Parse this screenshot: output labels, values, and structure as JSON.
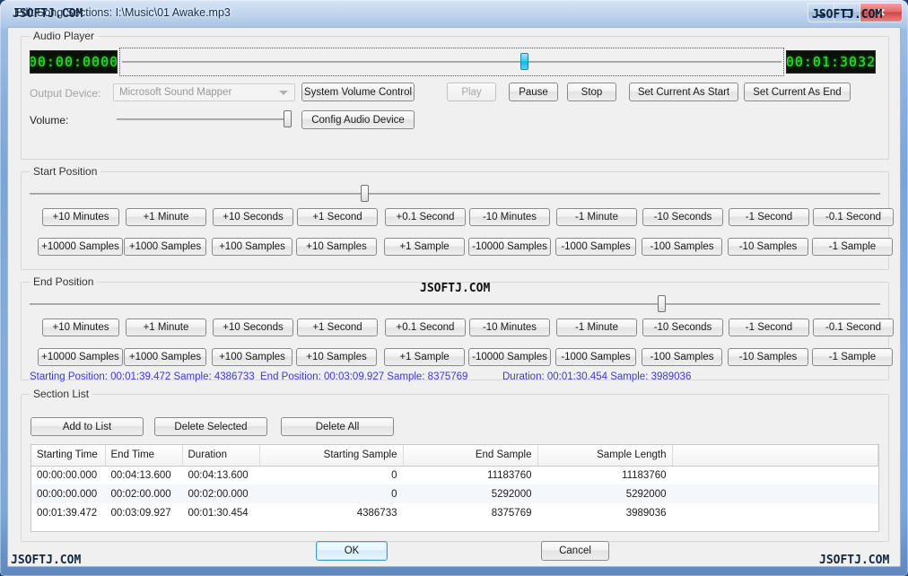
{
  "window": {
    "title": "Edit Song Sections:  I:\\Music\\01  Awake.mp3",
    "minimize_label": "minimize",
    "maximize_label": "maximize",
    "close_label": "✕"
  },
  "watermarks": {
    "title_left": "JSOFTJ.COM",
    "title_right": "JSOFTJ.COM",
    "middle": "JSOFTJ.COM",
    "bottom_left": "JSOFTJ.COM",
    "bottom_right": "JSOFTJ.COM"
  },
  "audio_player": {
    "group_title": "Audio Player",
    "lcd_left": {
      "ghost": "88:88:8888",
      "value": "00:00:0000"
    },
    "lcd_right": {
      "ghost": "88:88:8888",
      "value": "00:01:3032"
    },
    "seek_slider": {
      "name": "playback-position-slider",
      "percent": 61.2
    },
    "output_device_label": "Output Device:",
    "output_device_value": "Microsoft Sound Mapper",
    "volume_label": "Volume:",
    "volume_percent": 100,
    "buttons": [
      {
        "id": "system-volume-control",
        "label": "System Volume Control",
        "disabled": false
      },
      {
        "id": "play",
        "label": "Play",
        "disabled": true
      },
      {
        "id": "pause",
        "label": "Pause",
        "disabled": false
      },
      {
        "id": "stop",
        "label": "Stop",
        "disabled": false
      },
      {
        "id": "set-current-as-start",
        "label": "Set Current As Start",
        "disabled": false
      },
      {
        "id": "set-current-as-end",
        "label": "Set Current As End",
        "disabled": false
      },
      {
        "id": "config-audio-device",
        "label": "Config Audio Device",
        "disabled": false
      }
    ]
  },
  "start_position": {
    "group_title": "Start Position",
    "slider_percent": 39.3,
    "row1": [
      "+10 Minutes",
      "+1 Minute",
      "+10 Seconds",
      "+1 Second",
      "+0.1 Second",
      "-10 Minutes",
      "-1 Minute",
      "-10 Seconds",
      "-1 Second",
      "-0.1 Second"
    ],
    "row2": [
      "+10000 Samples",
      "+1000 Samples",
      "+100 Samples",
      "+10 Samples",
      "+1 Sample",
      "-10000 Samples",
      "-1000 Samples",
      "-100 Samples",
      "-10 Samples",
      "-1 Sample"
    ]
  },
  "end_position": {
    "group_title": "End Position",
    "slider_percent": 74.5,
    "row1": [
      "+10 Minutes",
      "+1 Minute",
      "+10 Seconds",
      "+1 Second",
      "+0.1 Second",
      "-10 Minutes",
      "-1 Minute",
      "-10 Seconds",
      "-1 Second",
      "-0.1 Second"
    ],
    "row2": [
      "+10000 Samples",
      "+1000 Samples",
      "+100 Samples",
      "+10 Samples",
      "+1 Sample",
      "-10000 Samples",
      "-1000 Samples",
      "-100 Samples",
      "-10 Samples",
      "-1 Sample"
    ]
  },
  "info": {
    "starting_position": "Starting Position: 00:01:39.472  Sample: 4386733",
    "end_position": "End Position: 00:03:09.927  Sample: 8375769",
    "duration": "Duration: 00:01:30.454  Sample: 3989036"
  },
  "section_list": {
    "group_title": "Section List",
    "buttons": [
      {
        "id": "add-to-list",
        "label": "Add to List"
      },
      {
        "id": "delete-selected",
        "label": "Delete Selected"
      },
      {
        "id": "delete-all",
        "label": "Delete All"
      }
    ],
    "columns": [
      {
        "key": "starting_time",
        "label": "Starting Time",
        "align": "l"
      },
      {
        "key": "end_time",
        "label": "End Time",
        "align": "l"
      },
      {
        "key": "duration",
        "label": "Duration",
        "align": "l"
      },
      {
        "key": "starting_sample",
        "label": "Starting Sample",
        "align": "r"
      },
      {
        "key": "end_sample",
        "label": "End Sample",
        "align": "r"
      },
      {
        "key": "sample_length",
        "label": "Sample Length",
        "align": "r"
      },
      {
        "key": "spacer",
        "label": "",
        "align": "l"
      }
    ],
    "rows": [
      {
        "starting_time": "00:00:00.000",
        "end_time": "00:04:13.600",
        "duration": "00:04:13.600",
        "starting_sample": "0",
        "end_sample": "11183760",
        "sample_length": "11183760",
        "spacer": ""
      },
      {
        "starting_time": "00:00:00.000",
        "end_time": "00:02:00.000",
        "duration": "00:02:00.000",
        "starting_sample": "0",
        "end_sample": "5292000",
        "sample_length": "5292000",
        "spacer": ""
      },
      {
        "starting_time": "00:01:39.472",
        "end_time": "00:03:09.927",
        "duration": "00:01:30.454",
        "starting_sample": "4386733",
        "end_sample": "8375769",
        "sample_length": "3989036",
        "spacer": ""
      }
    ]
  },
  "footer": {
    "ok_label": "OK",
    "cancel_label": "Cancel"
  },
  "colors": {
    "info_text": "#3a3ad0",
    "lcd_green": "#2fe02f",
    "accent_blue": "#3c9dd0"
  }
}
